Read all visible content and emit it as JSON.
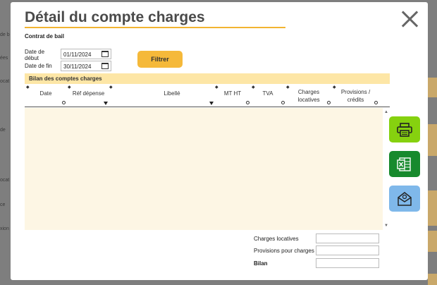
{
  "modal": {
    "title": "Détail du compte charges",
    "subtitle": "Contrat de bail"
  },
  "filters": {
    "start_label": "Date de début",
    "start_value": "01/11/2024",
    "end_label": "Date de fin",
    "end_value": "30/11/2024",
    "filter_button": "Filtrer"
  },
  "table": {
    "section_title": "Bilan des comptes charges",
    "columns": [
      "Date",
      "Réf dépense",
      "Libellé",
      "MT HT",
      "TVA",
      "Charges locatives",
      "Provisions / crédits"
    ],
    "rows": []
  },
  "side_actions": [
    {
      "name": "print",
      "color": "#86d10f"
    },
    {
      "name": "excel",
      "color": "#178a2d"
    },
    {
      "name": "email",
      "color": "#7fb8ea"
    }
  ],
  "footer": {
    "charges_label": "Charges locatives",
    "charges_value": "",
    "provisions_label": "Provisions pour charges",
    "provisions_value": "",
    "bilan_label": "Bilan",
    "bilan_value": ""
  }
}
